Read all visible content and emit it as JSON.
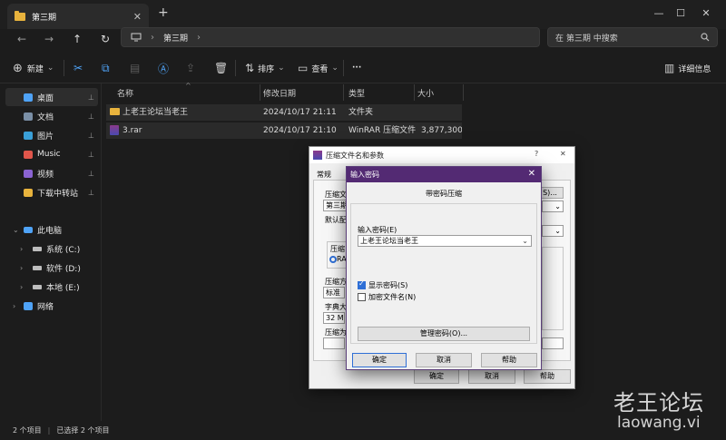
{
  "window": {
    "tab_title": "第三期",
    "tab_close": "✕",
    "new_tab": "+",
    "min": "—",
    "max": "☐",
    "close": "✕"
  },
  "nav": {
    "back": "←",
    "forward": "→",
    "up": "↑",
    "refresh": "↻",
    "address_sep": "›",
    "address_path": "第三期",
    "address_end": "›",
    "search_placeholder": "在 第三期 中搜索"
  },
  "toolbar": {
    "new": "新建",
    "sort": "排序",
    "view": "查看",
    "more": "···",
    "details": "详细信息"
  },
  "sidebar": {
    "quick": [
      {
        "label": "桌面",
        "color": "#4fa3f7",
        "pinned": true
      },
      {
        "label": "文档",
        "color": "#7a8fa6",
        "pinned": true
      },
      {
        "label": "图片",
        "color": "#3aa0d8",
        "pinned": true
      },
      {
        "label": "Music",
        "color": "#e0564b",
        "pinned": true
      },
      {
        "label": "视频",
        "color": "#8a63d2",
        "pinned": true
      },
      {
        "label": "下载中转站",
        "color": "#e8b33d",
        "pinned": true
      }
    ],
    "pin_glyph": "📌",
    "this_pc": "此电脑",
    "drives": [
      "系统 (C:)",
      "软件 (D:)",
      "本地 (E:)"
    ],
    "network": "网络"
  },
  "columns": {
    "name": "名称",
    "modified": "修改日期",
    "type": "类型",
    "size": "大小"
  },
  "files": [
    {
      "name": "上老王论坛当老王",
      "modified": "2024/10/17 21:11",
      "type": "文件夹",
      "size": ""
    },
    {
      "name": "3.rar",
      "modified": "2024/10/17 21:10",
      "type": "WinRAR 压缩文件",
      "size": "3,877,300..."
    }
  ],
  "status": {
    "count": "2 个项目",
    "selected": "已选择 2 个项目"
  },
  "rar_dialog": {
    "title": "压缩文件名和参数",
    "help_q": "?",
    "close": "✕",
    "tab_general": "常规",
    "archive_name_label": "压缩文",
    "archive_name_value": "第三期",
    "browse_suffix": "S)...",
    "default_profile": "默认配",
    "format_label": "压缩",
    "format_radio": "RA",
    "method_label": "压缩方",
    "method_value": "标准",
    "dict_label": "字典大",
    "dict_value": "32 MB",
    "split_label": "压缩为",
    "ok": "确定",
    "cancel": "取消",
    "help": "帮助"
  },
  "pw_dialog": {
    "title": "输入密码",
    "close": "✕",
    "heading": "带密码压缩",
    "label": "输入密码(E)",
    "value": "上老王论坛当老王",
    "show_password": "显示密码(S)",
    "show_password_checked": true,
    "encrypt_names": "加密文件名(N)",
    "encrypt_names_checked": false,
    "manage": "管理密码(O)...",
    "ok": "确定",
    "cancel": "取消",
    "help": "帮助"
  },
  "watermark": {
    "cn": "老王论坛",
    "en": "laowang.vi"
  }
}
